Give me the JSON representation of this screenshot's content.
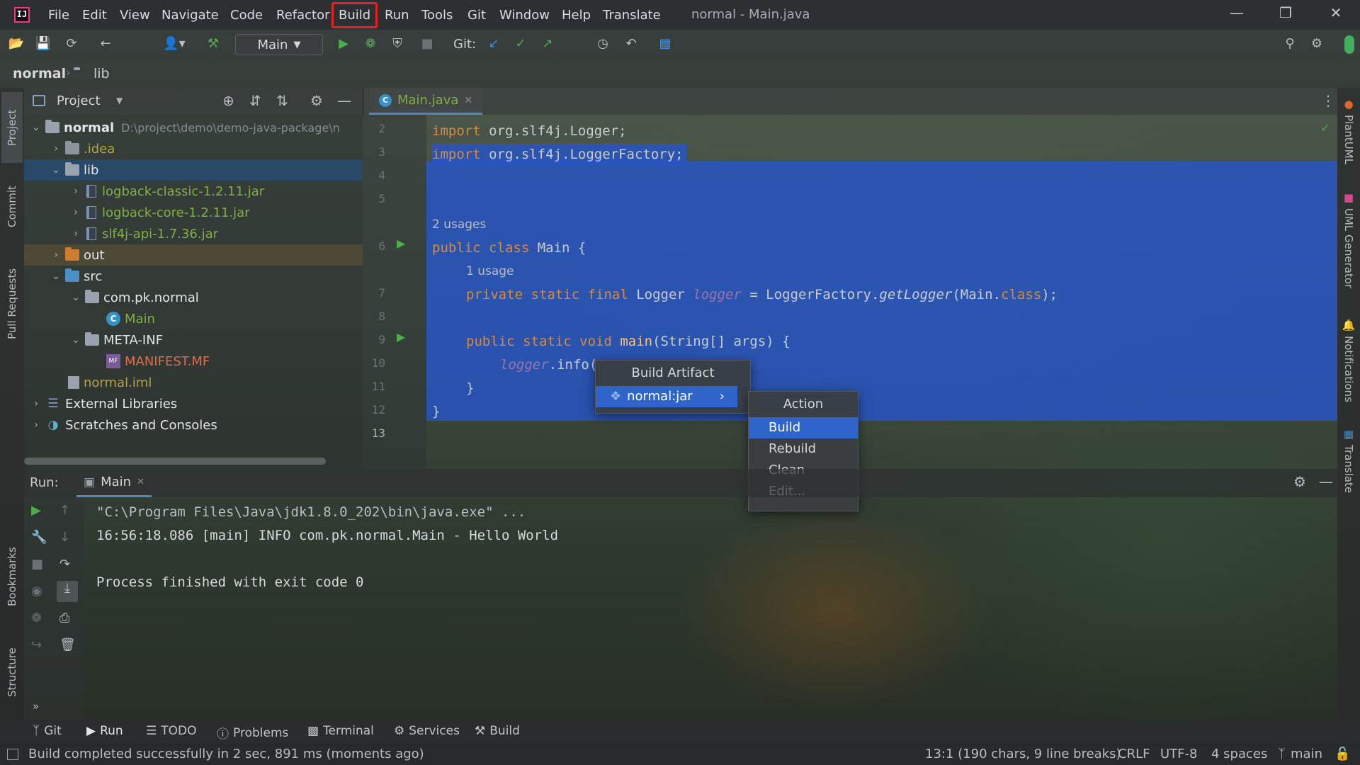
{
  "titlebar": {
    "menu": [
      "File",
      "Edit",
      "View",
      "Navigate",
      "Code",
      "Refactor",
      "Build",
      "Run",
      "Tools",
      "Git",
      "Window",
      "Help",
      "Translate"
    ],
    "window_title": "normal - Main.java"
  },
  "toolbar": {
    "run_config": "Main",
    "git_label": "Git:"
  },
  "breadcrumb": {
    "project": "normal",
    "folder": "lib"
  },
  "left_stripe": {
    "project": "Project",
    "commit": "Commit",
    "pull_requests": "Pull Requests",
    "bookmarks": "Bookmarks",
    "structure": "Structure"
  },
  "right_stripe": {
    "plantuml": "PlantUML",
    "uml_generator": "UML Generator",
    "notifications": "Notifications",
    "translate": "Translate"
  },
  "project_panel": {
    "title": "Project",
    "tree": [
      {
        "label": "normal",
        "path": "D:\\project\\demo\\demo-java-package\\n"
      },
      {
        "label": ".idea"
      },
      {
        "label": "lib"
      },
      {
        "label": "logback-classic-1.2.11.jar"
      },
      {
        "label": "logback-core-1.2.11.jar"
      },
      {
        "label": "slf4j-api-1.7.36.jar"
      },
      {
        "label": "out"
      },
      {
        "label": "src"
      },
      {
        "label": "com.pk.normal"
      },
      {
        "label": "Main"
      },
      {
        "label": "META-INF"
      },
      {
        "label": "MANIFEST.MF"
      },
      {
        "label": "normal.iml"
      },
      {
        "label": "External Libraries"
      },
      {
        "label": "Scratches and Consoles"
      }
    ]
  },
  "editor": {
    "tab": "Main.java",
    "line_numbers": [
      "2",
      "3",
      "4",
      "5",
      "6",
      "7",
      "8",
      "9",
      "10",
      "11",
      "12",
      "13"
    ],
    "code": {
      "l3a": "import",
      "l3b": " org.slf4j.Logger;",
      "l4a": "import",
      "l4b": " org.slf4j.LoggerFactory;",
      "usages2": "2 usages",
      "l6a": "public class",
      "l6b": " Main {",
      "usage1": "1 usage",
      "l7a": "private static final",
      "l7b": " Logger ",
      "l7c": "logger",
      "l7d": " = LoggerFactory.",
      "l7e": "getLogger",
      "l7f": "(Main.",
      "l7g": "class",
      "l7h": ");",
      "l9a": "public static void",
      "l9b": " main",
      "l9c": "(String[] args) {",
      "l10a": "logger",
      "l10b": ".info(",
      "l11": "}",
      "l12": "}"
    }
  },
  "popup_artifact": {
    "title": "Build Artifact",
    "item": "normal:jar"
  },
  "popup_action": {
    "title": "Action",
    "items": [
      "Build",
      "Rebuild",
      "Clean",
      "Edit..."
    ]
  },
  "run_panel": {
    "label": "Run:",
    "tab": "Main",
    "console": [
      "\"C:\\Program Files\\Java\\jdk1.8.0_202\\bin\\java.exe\" ...",
      "16:56:18.086 [main] INFO com.pk.normal.Main - Hello World",
      "",
      "Process finished with exit code 0"
    ]
  },
  "bottom_tools": [
    "Git",
    "Run",
    "TODO",
    "Problems",
    "Terminal",
    "Services",
    "Build"
  ],
  "status": {
    "message": "Build completed successfully in 2 sec, 891 ms (moments ago)",
    "position": "13:1 (190 chars, 9 line breaks)",
    "line_sep": "CRLF",
    "encoding": "UTF-8",
    "indent": "4 spaces",
    "branch": "main"
  },
  "colors": {
    "selection": "#2656c8",
    "accent": "#2f65ca",
    "highlight_box": "#e8201f",
    "keyword": "#d78a3e",
    "jar_text": "#7fae46"
  }
}
